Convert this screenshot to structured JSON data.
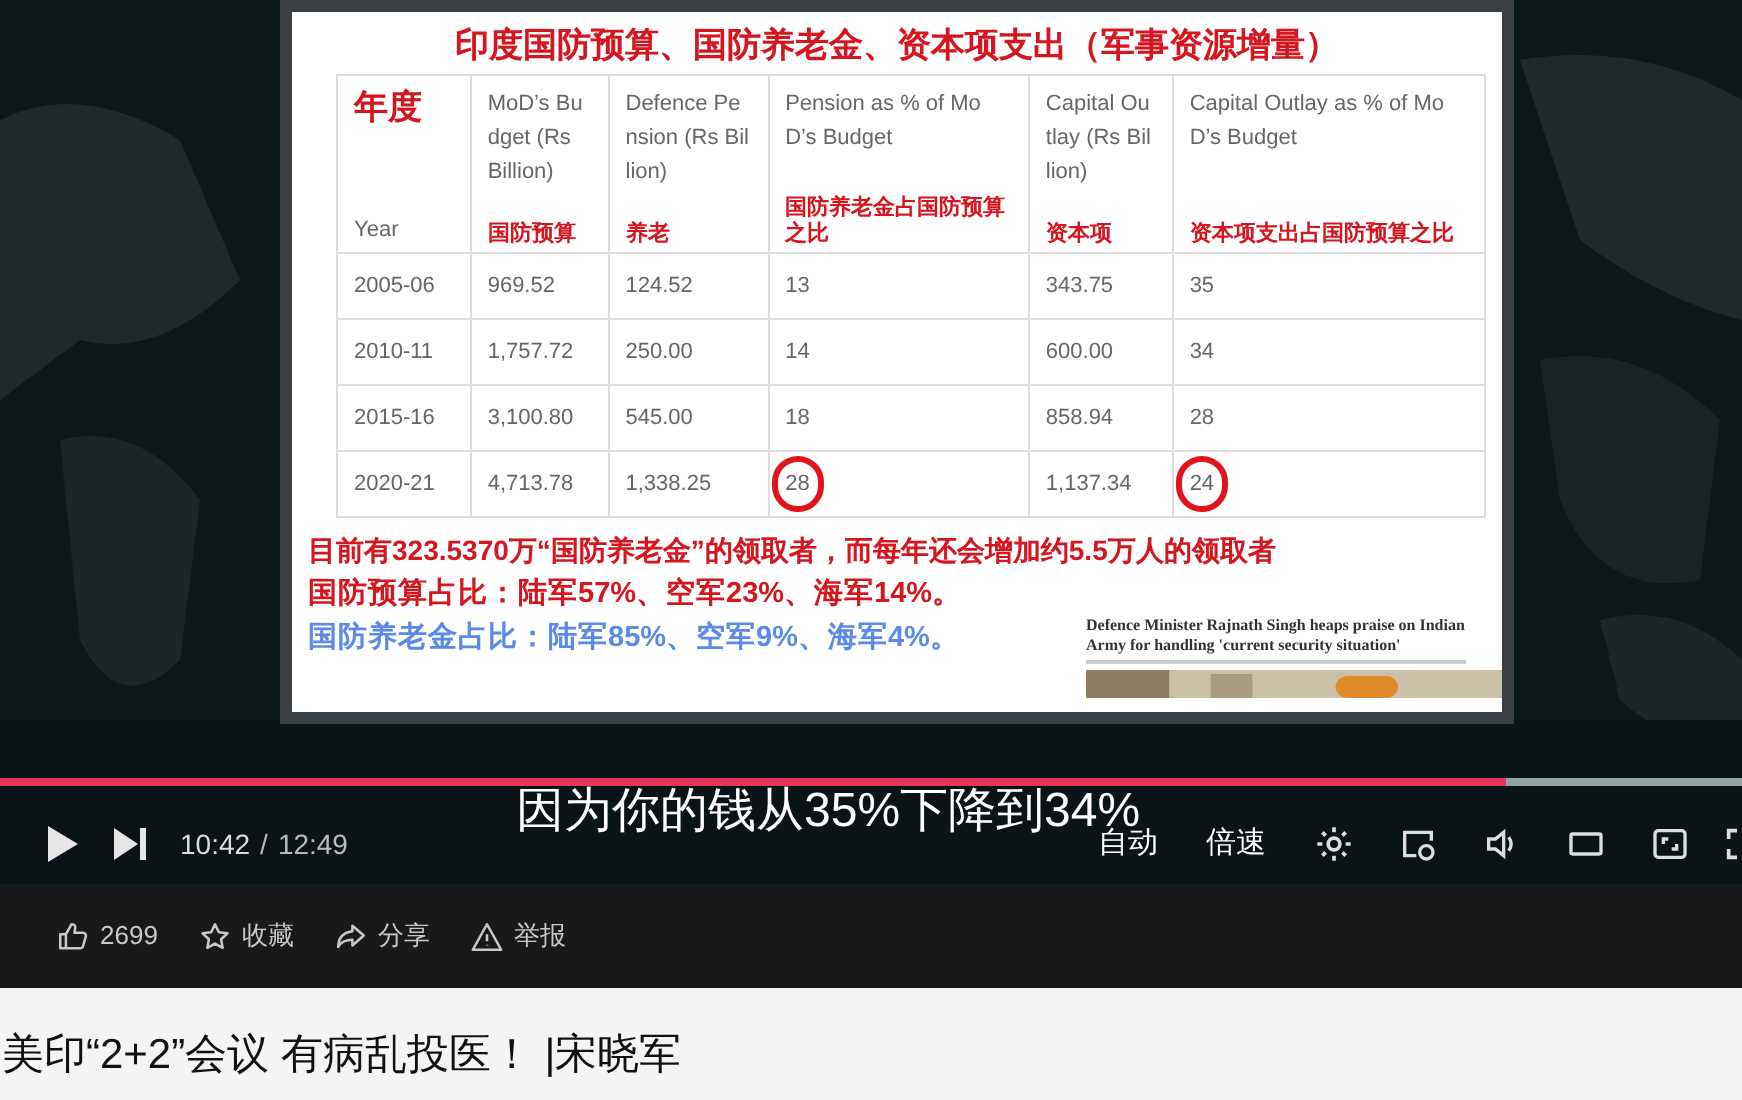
{
  "video": {
    "slide": {
      "title": "印度国防预算、国防养老金、资本项支出（军事资源增量）",
      "table": {
        "columns": [
          {
            "label": "Year",
            "note": "年度",
            "note_above": true
          },
          {
            "label": "MoD’s Budget (Rs Billion)",
            "note": "国防预算",
            "note_above": false
          },
          {
            "label": "Defence Pension (Rs Billion)",
            "note": "养老",
            "note_above": false
          },
          {
            "label": "Pension as % of MoD’s Budget",
            "note": "国防养老金占国防预算之比",
            "note_above": false
          },
          {
            "label": "Capital Outlay (Rs Billion)",
            "note": "资本项",
            "note_above": false
          },
          {
            "label": "Capital Outlay as % of MoD’s Budget",
            "note": "资本项支出占国防预算之比",
            "note_above": false
          }
        ],
        "rows": [
          {
            "cells": [
              {
                "text": "2005-06",
                "circled": false
              },
              {
                "text": "969.52",
                "circled": false
              },
              {
                "text": "124.52",
                "circled": false
              },
              {
                "text": "13",
                "circled": false
              },
              {
                "text": "343.75",
                "circled": false
              },
              {
                "text": "35",
                "circled": false
              }
            ]
          },
          {
            "cells": [
              {
                "text": "2010-11",
                "circled": false
              },
              {
                "text": "1,757.72",
                "circled": false
              },
              {
                "text": "250.00",
                "circled": false
              },
              {
                "text": "14",
                "circled": false
              },
              {
                "text": "600.00",
                "circled": false
              },
              {
                "text": "34",
                "circled": false
              }
            ]
          },
          {
            "cells": [
              {
                "text": "2015-16",
                "circled": false
              },
              {
                "text": "3,100.80",
                "circled": false
              },
              {
                "text": "545.00",
                "circled": false
              },
              {
                "text": "18",
                "circled": false
              },
              {
                "text": "858.94",
                "circled": false
              },
              {
                "text": "28",
                "circled": false
              }
            ]
          },
          {
            "cells": [
              {
                "text": "2020-21",
                "circled": false
              },
              {
                "text": "4,713.78",
                "circled": false
              },
              {
                "text": "1,338.25",
                "circled": false
              },
              {
                "text": "28",
                "circled": true
              },
              {
                "text": "1,137.34",
                "circled": false
              },
              {
                "text": "24",
                "circled": true
              }
            ]
          }
        ]
      },
      "notes": [
        {
          "text": "目前有323.5370万“国防养老金”的领取者，而每年还会增加约5.5万人的领取者",
          "color": "#d6161e"
        },
        {
          "text": "国防预算占比：陆军57%、空军23%、海军14%。",
          "color": "#d6161e"
        },
        {
          "text": "国防养老金占比：陆军85%、空军9%、海军4%。",
          "color": "#5b8be6"
        }
      ],
      "clipping": {
        "headline": "Defence Minister Rajnath Singh heaps praise on Indian Army for handling 'current security situation'"
      }
    },
    "subtitle": "因为你的钱从35%下降到34%",
    "progress": {
      "level": 0.865
    },
    "time": {
      "current": "10:42",
      "separator": "/",
      "total": "12:49"
    },
    "text_buttons": [
      "自动",
      "倍速"
    ]
  },
  "actions": [
    {
      "kind": "like",
      "label": "2699"
    },
    {
      "kind": "favorite",
      "label": "收藏"
    },
    {
      "kind": "share",
      "label": "分享"
    },
    {
      "kind": "report",
      "label": "举报"
    }
  ],
  "title": "美印“2+2”会议 有病乱投医！ |宋晓军"
}
